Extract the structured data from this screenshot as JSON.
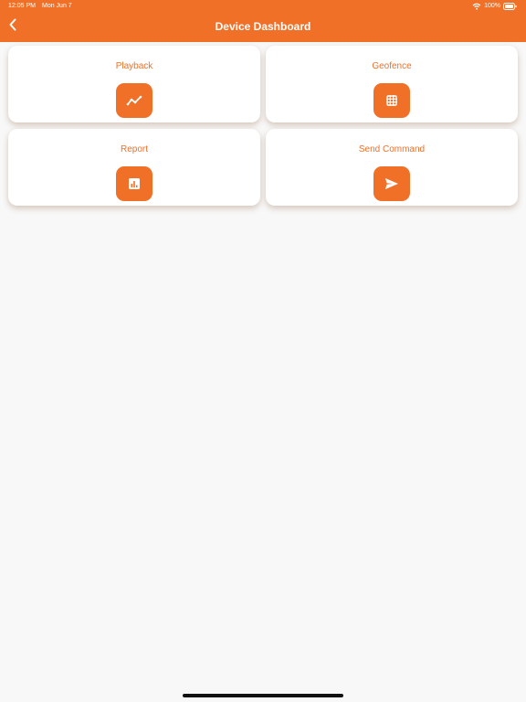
{
  "status_bar": {
    "time": "12:05 PM",
    "date": "Mon Jun 7",
    "battery": "100%",
    "wifi_icon": "wifi-icon",
    "battery_icon": "battery-icon"
  },
  "header": {
    "title": "Device Dashboard",
    "back_icon": "chevron-left-icon",
    "background_color": "#f07027"
  },
  "cards": [
    {
      "label": "Playback",
      "icon": "trend-line-icon"
    },
    {
      "label": "Geofence",
      "icon": "grid-icon"
    },
    {
      "label": "Report",
      "icon": "bar-chart-icon"
    },
    {
      "label": "Send Command",
      "icon": "send-icon"
    }
  ],
  "colors": {
    "accent": "#f07027",
    "background": "#f8f8f8",
    "card": "#ffffff"
  }
}
